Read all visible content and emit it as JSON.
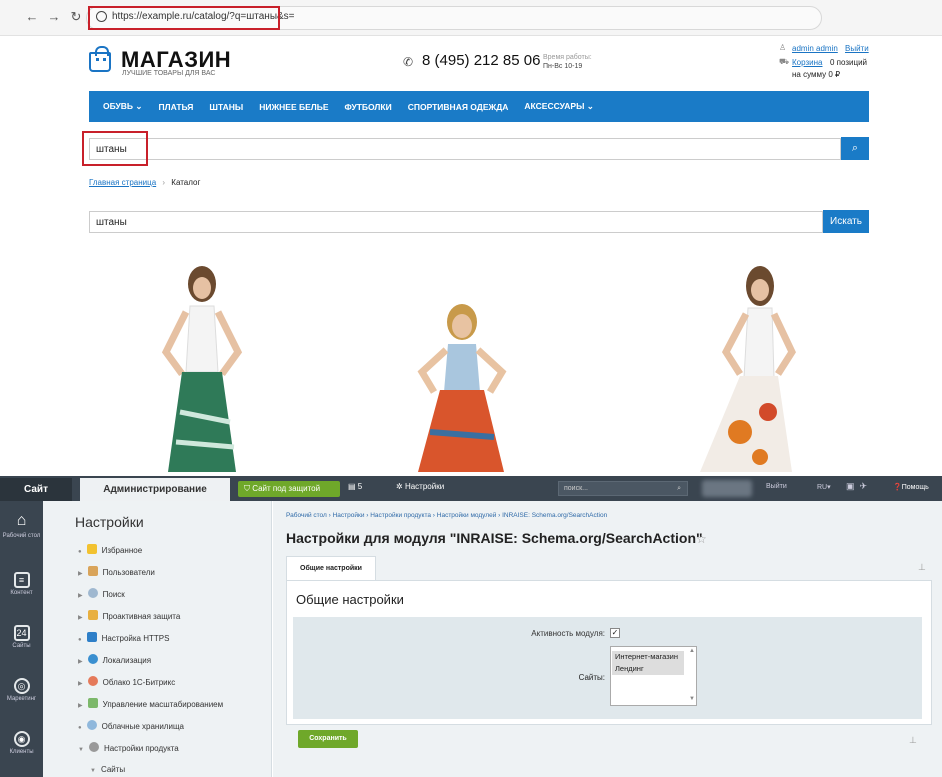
{
  "browser": {
    "url": "https://example.ru/catalog/?q=штаны&s="
  },
  "shop": {
    "logo_title": "МАГАЗИН",
    "logo_subtitle": "ЛУЧШИЕ ТОВАРЫ ДЛЯ ВАС",
    "phone": "8 (495) 212 85 06",
    "hours_label": "Время работы:",
    "hours_value": "Пн-Вс 10-19",
    "user_link": "admin admin",
    "logout": "Выйти",
    "cart_link": "Корзина",
    "cart_count": "0 позиций",
    "cart_sum": "на сумму 0 ₽",
    "menu": [
      "ОБУВЬ ⌄",
      "ПЛАТЬЯ",
      "ШТАНЫ",
      "НИЖНЕЕ БЕЛЬЕ",
      "ФУТБОЛКИ",
      "СПОРТИВНАЯ ОДЕЖДА",
      "АКСЕССУАРЫ ⌄"
    ],
    "search_value": "штаны",
    "breadcrumb_home": "Главная страница",
    "breadcrumb_current": "Каталог",
    "search2_value": "штаны",
    "search2_button": "Искать"
  },
  "admin": {
    "tab_site": "Сайт",
    "tab_admin": "Администрирование",
    "protect_label": "Сайт под защитой",
    "counter": "5",
    "settings_label": "Настройки",
    "search_placeholder": "поиск...",
    "exit": "Выйти",
    "lang": "RU",
    "help": "Помощь",
    "leftnav": [
      "Рабочий стол",
      "Контент",
      "Сайты",
      "Маркетинг",
      "Клиенты"
    ],
    "sidebar_title": "Настройки",
    "sidebar_items": [
      "Избранное",
      "Пользователи",
      "Поиск",
      "Проактивная защита",
      "Настройка HTTPS",
      "Локализация",
      "Облако 1С-Битрикс",
      "Управление масштабированием",
      "Облачные хранилища",
      "Настройки продукта",
      "Сайты"
    ],
    "breadcrumb": "Рабочий стол  ›  Настройки  ›  Настройки продукта  ›  Настройки модулей  ›  INRAISE: Schema.org/SearchAction",
    "page_title": "Настройки для модуля \"INRAISE: Schema.org/SearchAction\"",
    "tab_general": "Общие настройки",
    "card_title": "Общие настройки",
    "label_active": "Активность модуля:",
    "label_sites": "Сайты:",
    "site_options": [
      "Интернет-магазин",
      "Лендинг"
    ],
    "save": "Сохранить"
  }
}
